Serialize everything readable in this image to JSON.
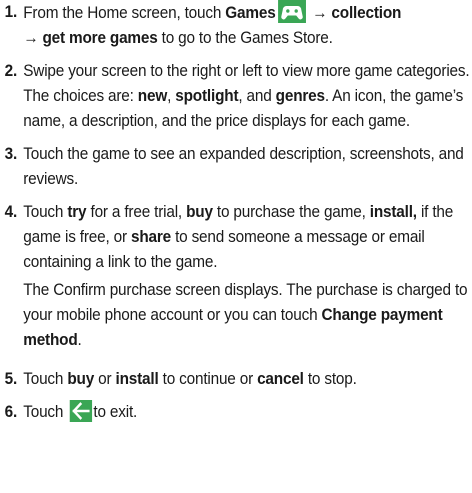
{
  "steps": [
    {
      "number": "1.",
      "t1": "From the Home screen, touch ",
      "b1": "Games",
      "icon": "games-controller-icon",
      "arrow1": " → ",
      "b2": "collection",
      "arrow2": "→ ",
      "b3": "get more games",
      "t2": " to go to the Games Store."
    },
    {
      "number": "2.",
      "t1": "Swipe your screen to the right or left to view more game categories. The choices are: ",
      "b1": "new",
      "t2": ", ",
      "b2": "spotlight",
      "t3": ", and ",
      "b3": "genres",
      "t4": ". An icon, the game’s name, a description, and the price displays for each game."
    },
    {
      "number": "3.",
      "t1": "Touch the game to see an expanded description, screenshots, and reviews."
    },
    {
      "number": "4.",
      "t1": "Touch ",
      "b1": "try",
      "t2": " for a free trial, ",
      "b2": "buy",
      "t3": " to purchase the game, ",
      "b3": "install,",
      "t4": " if the game is free, or ",
      "b4": "share",
      "t5": " to send someone a message or email containing a link to the game.",
      "p2_t1": "The Confirm purchase screen displays. The purchase is charged to your mobile phone account or you can touch ",
      "p2_b1": "Change payment method",
      "p2_t2": "."
    },
    {
      "number": "5.",
      "t1": "Touch ",
      "b1": "buy",
      "t2": " or ",
      "b2": "install",
      "t3": " to continue or ",
      "b3": "cancel",
      "t4": " to stop."
    },
    {
      "number": "6.",
      "t1": "Touch ",
      "icon": "back-arrow-icon",
      "t2": "to exit."
    }
  ],
  "colors": {
    "icon_bg": "#3aa655",
    "text": "#1a1a1a"
  }
}
